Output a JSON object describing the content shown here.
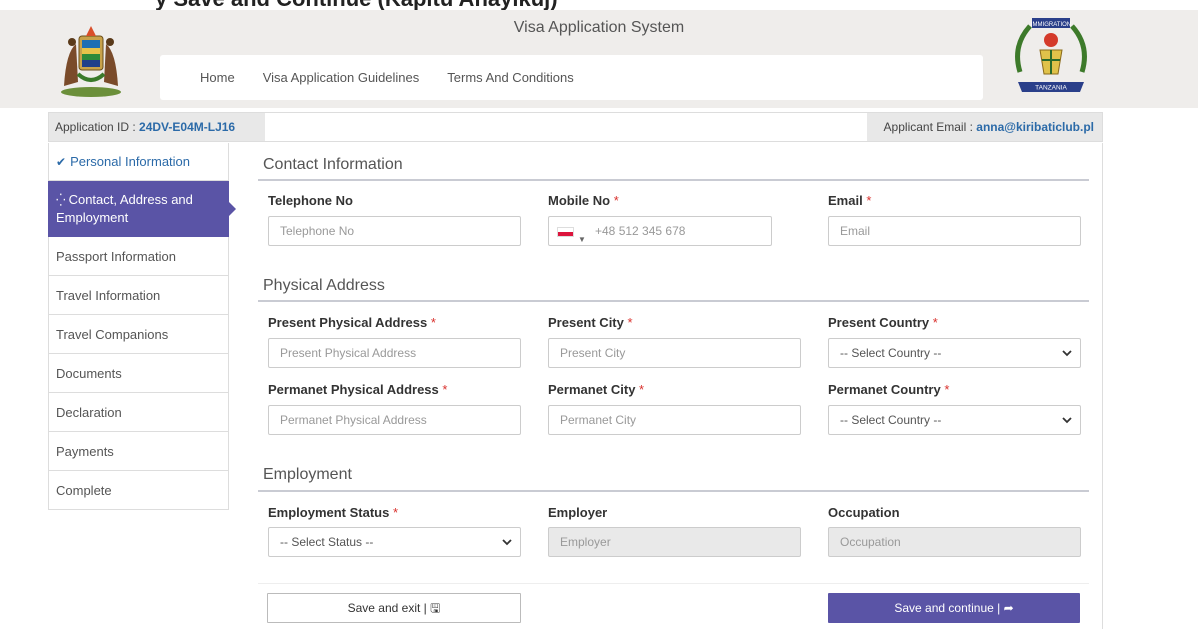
{
  "banner": {
    "cut_text": "y Save and Continue (Kapitu Anayikuj)"
  },
  "header": {
    "title": "Visa Application System",
    "nav": [
      "Home",
      "Visa Application Guidelines",
      "Terms And Conditions"
    ],
    "right_logo_text": "IMMIGRATION",
    "right_logo_banner": "TANZANIA"
  },
  "application": {
    "id_label": "Application ID : ",
    "id_value": "24DV-E04M-LJ16",
    "email_label": "Applicant Email : ",
    "email_value": "anna@kiribaticlub.pl"
  },
  "steps": [
    {
      "label": "Personal Information",
      "state": "done"
    },
    {
      "label": "Contact, Address and Employment",
      "state": "active"
    },
    {
      "label": "Passport Information",
      "state": "pending"
    },
    {
      "label": "Travel Information",
      "state": "pending"
    },
    {
      "label": "Travel Companions",
      "state": "pending"
    },
    {
      "label": "Documents",
      "state": "pending"
    },
    {
      "label": "Declaration",
      "state": "pending"
    },
    {
      "label": "Payments",
      "state": "pending"
    },
    {
      "label": "Complete",
      "state": "pending"
    }
  ],
  "contact": {
    "title": "Contact Information",
    "telephone_label": "Telephone No",
    "telephone_placeholder": "Telephone No",
    "mobile_label": "Mobile No",
    "mobile_placeholder": "+48 512 345 678",
    "email_label": "Email",
    "email_placeholder": "Email"
  },
  "address": {
    "title": "Physical Address",
    "present_address_label": "Present Physical Address",
    "present_address_placeholder": "Present Physical Address",
    "present_city_label": "Present City",
    "present_city_placeholder": "Present City",
    "present_country_label": "Present Country",
    "present_country_value": "-- Select Country --",
    "perm_address_label": "Permanet Physical Address",
    "perm_address_placeholder": "Permanet Physical Address",
    "perm_city_label": "Permanet City",
    "perm_city_placeholder": "Permanet City",
    "perm_country_label": "Permanet Country",
    "perm_country_value": "-- Select Country --"
  },
  "employment": {
    "title": "Employment",
    "status_label": "Employment Status",
    "status_value": "-- Select Status --",
    "employer_label": "Employer",
    "employer_placeholder": "Employer",
    "occupation_label": "Occupation",
    "occupation_placeholder": "Occupation"
  },
  "required_mark": "*",
  "buttons": {
    "save_exit": "Save and exit | 🖫",
    "save_continue": "Save and continue | ➦"
  },
  "colors": {
    "accent": "#5a54a6",
    "link": "#2b6aa8",
    "required": "#d9302c"
  }
}
